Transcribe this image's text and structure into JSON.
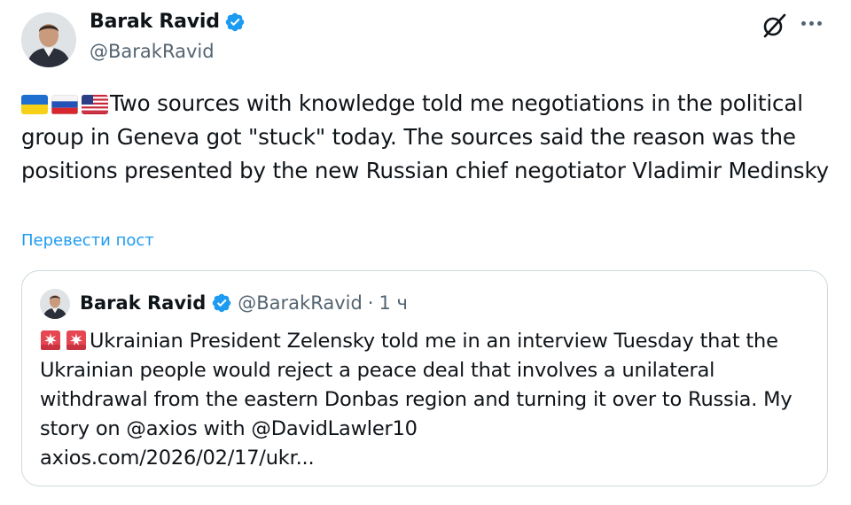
{
  "tweet": {
    "author": {
      "name": "Barak Ravid",
      "handle": "@BarakRavid",
      "verified": true
    },
    "flags": [
      "ukraine-flag",
      "russia-flag",
      "usa-flag"
    ],
    "text": "Two sources with knowledge told me negotiations in the political group in Geneva got \"stuck\" today. The sources said the reason was the positions presented by the new Russian chief negotiator Vladimir Medinsky",
    "translate_label": "Перевести пост"
  },
  "quote": {
    "author": {
      "name": "Barak Ravid",
      "handle": "@BarakRavid",
      "verified": true
    },
    "separator": "·",
    "time": "1 ч",
    "emoji": [
      "siren-icon",
      "siren-icon"
    ],
    "text": "Ukrainian President Zelensky told me in an interview Tuesday that the Ukrainian people would reject a peace deal that involves a unilateral withdrawal from the eastern Donbas region and turning it over to Russia. My story on @axios with @DavidLawler10",
    "link": "axios.com/2026/02/17/ukr..."
  },
  "colors": {
    "verified": "#1d9bf0",
    "link": "#1d9bf0",
    "secondary_text": "#536471",
    "border": "#cfd9de"
  }
}
